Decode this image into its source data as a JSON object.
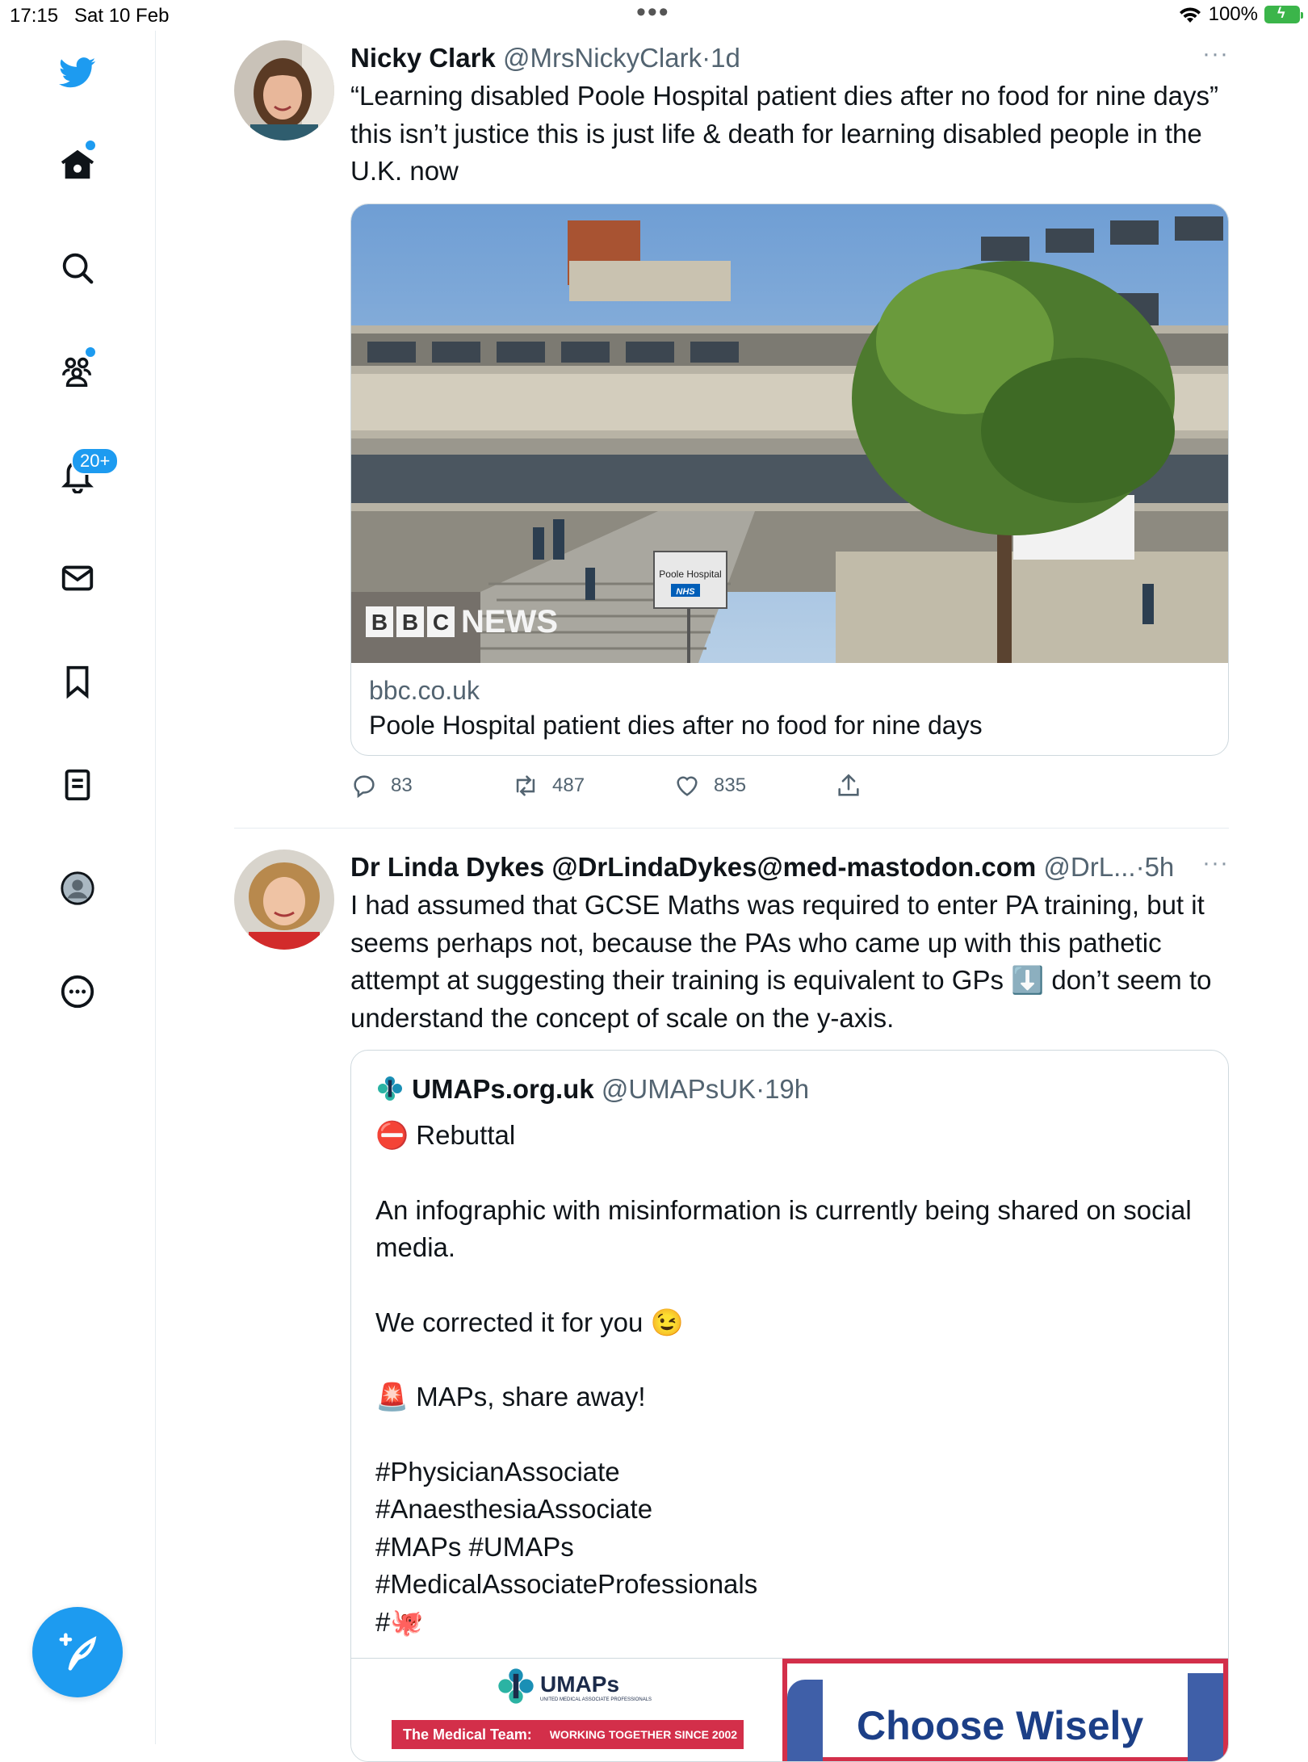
{
  "status_bar": {
    "time": "17:15",
    "date": "Sat 10 Feb",
    "dots": "•••",
    "battery": "100%"
  },
  "sidebar": {
    "items": [
      "twitter-logo",
      "home",
      "search",
      "communities",
      "notifications",
      "messages",
      "bookmarks",
      "lists",
      "profile",
      "more"
    ],
    "notifications_badge": "20+"
  },
  "colors": {
    "accent": "#1d9bf0",
    "text": "#0f1419",
    "secondary": "#536471",
    "border": "#cfd9de"
  },
  "tweets": [
    {
      "name": "Nicky Clark",
      "handle": "@MrsNickyClark",
      "sep": "·",
      "time": "1d",
      "more": "···",
      "text": "“Learning disabled Poole Hospital patient dies after no food for nine days” this isn’t justice this is just life & death for learning disabled people in the U.K. now",
      "card": {
        "image_watermark_letters": [
          "B",
          "B",
          "C"
        ],
        "image_watermark_word": "NEWS",
        "sign_text": "Poole Hospital",
        "sign_sub": "NHS",
        "domain": "bbc.co.uk",
        "title": "Poole Hospital patient dies after no food for nine days"
      },
      "replies": "83",
      "retweets": "487",
      "likes": "835"
    },
    {
      "name": "Dr Linda Dykes @DrLindaDykes@med-mastodon.com",
      "handle": "@DrL...",
      "sep": "·",
      "time": "5h",
      "more": "···",
      "text": "I had assumed that GCSE Maths was required to enter PA training, but it seems perhaps not, because the PAs who came up with this pathetic attempt at suggesting their training is equivalent to GPs ⬇️ don’t seem to understand the concept of scale on the y-axis.",
      "quote": {
        "name": "UMAPs.org.uk",
        "handle": "@UMAPsUK",
        "sep": "·",
        "time": "19h",
        "line1": "⛔ Rebuttal",
        "line2": "An infographic with misinformation is currently being shared on social media.",
        "line3": "We corrected it for you 😉",
        "line4": "🚨 MAPs, share away!",
        "hashtags": [
          "#PhysicianAssociate",
          "#AnaesthesiaAssociate",
          "#MAPs #UMAPs",
          "#MedicalAssociateProfessionals",
          "#🐙"
        ],
        "infographic_left_logo": "UMAPs",
        "infographic_left_sub": "UNITED MEDICAL ASSOCIATE PROFESSIONALS",
        "infographic_left_banner_a": "The Medical Team:",
        "infographic_left_banner_b": "WORKING TOGETHER SINCE 2002",
        "infographic_right_title": "Choose Wisely"
      }
    }
  ]
}
